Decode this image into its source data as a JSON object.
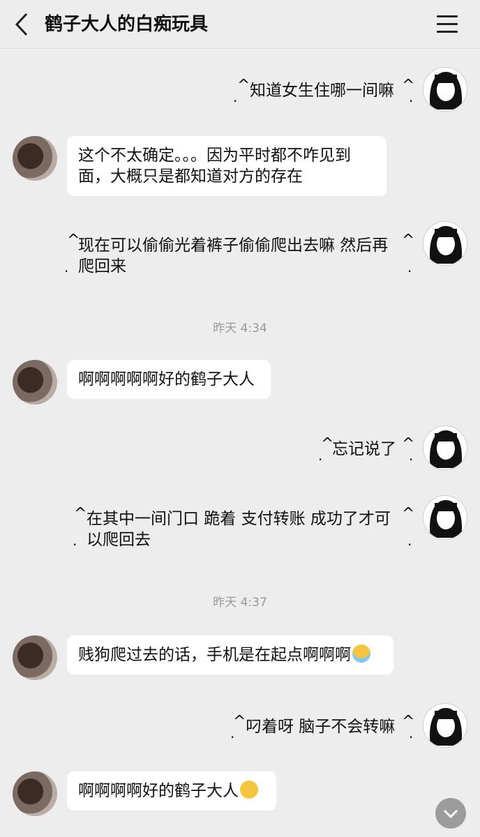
{
  "header": {
    "title": "鹤子大人的白痴玩具"
  },
  "messages": [
    {
      "self": true,
      "text": "知道女生住哪一间嘛"
    },
    {
      "self": false,
      "text": "这个不太确定。。。因为平时都不咋见到面，大概只是都知道对方的存在"
    },
    {
      "self": true,
      "line1": "现在可以偷偷光着裤子偷偷爬出去嘛 然后再",
      "line2": "爬回来"
    },
    {
      "time": "昨天 4:34"
    },
    {
      "self": false,
      "text": "啊啊啊啊啊好的鹤子大人"
    },
    {
      "self": true,
      "text": "忘记说了"
    },
    {
      "self": true,
      "line1": "在其中一间门口 跪着 支付转账 成功了才可",
      "line2": "以爬回去"
    },
    {
      "time": "昨天 4:37"
    },
    {
      "self": false,
      "text": "贱狗爬过去的话，手机是在起点啊啊啊",
      "emoji": "loudly-crying-emoji"
    },
    {
      "self": true,
      "text": "叼着呀 脑子不会转嘛"
    },
    {
      "self": false,
      "text": "啊啊啊啊好的鹤子大人",
      "emoji": "dizzy-face-emoji"
    }
  ],
  "icons": {
    "back": "chevron-left-icon",
    "menu": "hamburger-menu-icon",
    "scroll": "chevron-down-icon"
  },
  "colors": {
    "background": "#ededed",
    "bubble": "#ffffff",
    "timestamp": "#999999"
  }
}
